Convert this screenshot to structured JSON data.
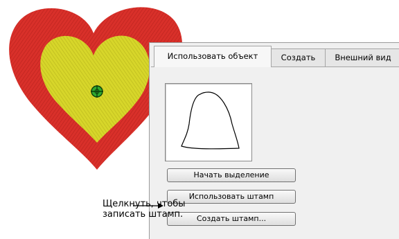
{
  "tabs": [
    {
      "label": "Использовать объект"
    },
    {
      "label": "Создать"
    },
    {
      "label": "Внешний вид"
    }
  ],
  "buttons": {
    "start_selection": "Начать выделение",
    "use_stamp": "Использовать штамп",
    "create_stamp": "Создать штамп..."
  },
  "callout": {
    "line1": "Щелкнуть, чтобы",
    "line2": "записать штамп."
  },
  "colors": {
    "heart_outer": "#d9302a",
    "heart_inner": "#d7d62a",
    "target_marker": "#2fa82f"
  },
  "icons": {
    "preview_shape": "bell-outline-icon",
    "marker": "crosshair-target-icon"
  }
}
